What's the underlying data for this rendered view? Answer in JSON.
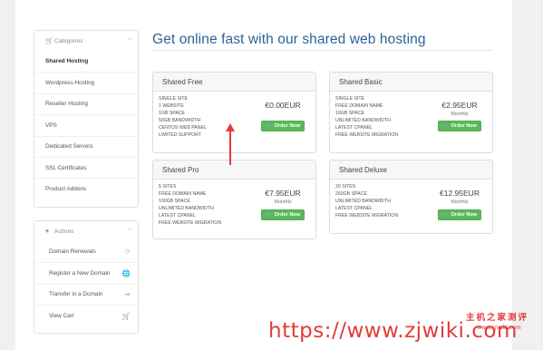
{
  "sidebar": {
    "categories": {
      "title": "Categories",
      "items": [
        {
          "label": "Shared Hosting"
        },
        {
          "label": "Wordpress Hosting"
        },
        {
          "label": "Reseller Hosting"
        },
        {
          "label": "VPS"
        },
        {
          "label": "Dedicated Servers"
        },
        {
          "label": "SSL Certificates"
        },
        {
          "label": "Product Addons"
        }
      ]
    },
    "actions": {
      "title": "Actions",
      "items": [
        {
          "label": "Domain Renewals",
          "icon": "refresh-icon"
        },
        {
          "label": "Register a New Domain",
          "icon": "globe-icon"
        },
        {
          "label": "Transfer in a Domain",
          "icon": "share-icon"
        },
        {
          "label": "View Cart",
          "icon": "cart-icon"
        }
      ]
    }
  },
  "main": {
    "heading": "Get online fast with our shared web hosting",
    "order_label": "Order Now",
    "products": [
      {
        "name": "Shared Free",
        "features": [
          "SINGLE SITE",
          "1 WEBSITE",
          "1GB SPACE",
          "50GB BANDWIDTH",
          "CENTOS WEB PANEL",
          "LIMITED SUPPORT"
        ],
        "price": "€0.00EUR",
        "period": ""
      },
      {
        "name": "Shared Basic",
        "features": [
          "SINGLE SITE",
          "FREE DOMAIN NAME",
          "10GB SPACE",
          "UNLIMITED BANDWIDTH",
          "LATEST CPANEL",
          "FREE WEBSITE MIGRATION"
        ],
        "price": "€2.95EUR",
        "period": "Monthly"
      },
      {
        "name": "Shared Pro",
        "features": [
          "5 SITES",
          "FREE DOMAIN NAME",
          "100GB SPACE",
          "UNLIMITED BANDWIDTH",
          "LATEST CPANEL",
          "FREE WEBSITE MIGRATION"
        ],
        "price": "€7.95EUR",
        "period": "Monthly"
      },
      {
        "name": "Shared Deluxe",
        "features": [
          "20 SITES",
          "250GB SPACE",
          "UNLIMITED BANDWIDTH",
          "LATEST CPANEL",
          "FREE WEBSITE MIGRATION"
        ],
        "price": "€12.95EUR",
        "period": "Monthly"
      }
    ]
  },
  "watermark": {
    "url": "https://www.zjwiki.com",
    "logo_text": "主机之家测评",
    "logo_url": "www.zjwiki.com"
  },
  "colors": {
    "accent_heading": "#2a6496",
    "order_button": "#5cb85c",
    "annotation_arrow": "#e83a3a"
  }
}
